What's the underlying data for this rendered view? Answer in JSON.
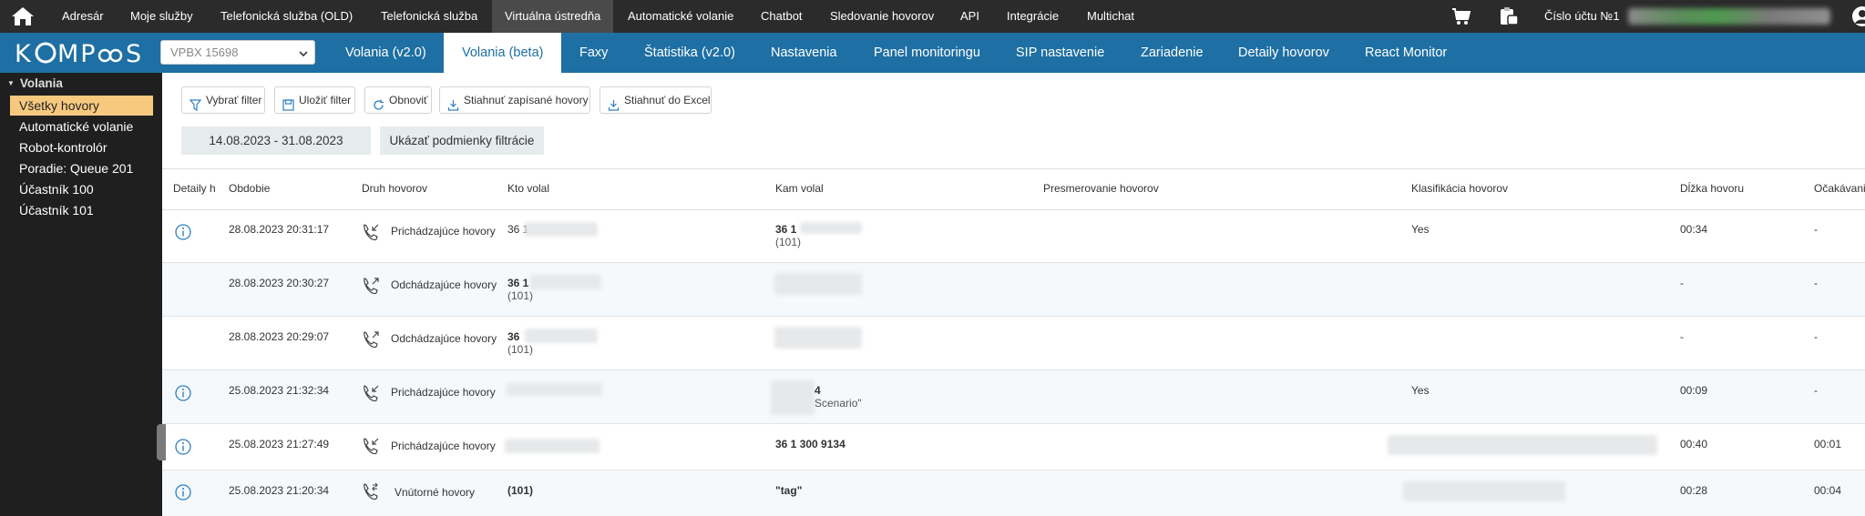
{
  "topnav": {
    "items": [
      "Adresár",
      "Moje služby",
      "Telefonická služba (OLD)",
      "Telefonická služba",
      "Virtuálna ústredňa",
      "Automatické volanie",
      "Chatbot",
      "Sledovanie hovorov",
      "API",
      "Integrácie",
      "Multichat"
    ],
    "active": "Virtuálna ústredňa",
    "account_label": "Číslo účtu №1"
  },
  "brand": {
    "logo_text": "KOMPaaS"
  },
  "pbx_select": {
    "value": "VPBX 15698"
  },
  "subtabs": [
    "Volania (v2.0)",
    "Volania (beta)",
    "Faxy",
    "Štatistika (v2.0)",
    "Nastavenia",
    "Panel monitoringu",
    "SIP nastavenie",
    "Zariadenie",
    "Detaily hovorov",
    "React Monitor"
  ],
  "sidebar": {
    "group": "Volania",
    "items": [
      "Všetky hovory",
      "Automatické volanie",
      "Robot-kontrolór",
      "Poradie: Queue 201",
      "Účastník 100",
      "Účastník 101"
    ]
  },
  "toolbar": {
    "select_filter": "Vybrať filter",
    "save_filter": "Uložiť filter",
    "refresh": "Obnoviť",
    "download_recorded": "Stiahnuť zapísané hovory",
    "download_excel": "Stiahnuť do Excel",
    "date_range": "14.08.2023 - 31.08.2023",
    "show_conditions": "Ukázať podmienky filtrácie"
  },
  "table": {
    "headers": [
      "Detaily h",
      "Obdobie",
      "Druh hovorov",
      "Kto volal",
      "Kam volal",
      "Presmerovanie hovorov",
      "Klasifikácia hovorov",
      "Dĺžka hovoru",
      "Očakávani"
    ],
    "rows": [
      {
        "period": "28.08.2023 20:31:17",
        "type": "Prichádzajúce hovory",
        "from": "36 1",
        "from_sub": "",
        "to": "36 1",
        "to_sub": "(101)",
        "class": "Yes",
        "dur": "00:34",
        "wait": "-"
      },
      {
        "period": "28.08.2023 20:30:27",
        "type": "Odchádzajúce hovory",
        "from": "36 1",
        "from_sub": "(101)",
        "to": "",
        "to_sub": "",
        "class": "",
        "dur": "-",
        "wait": "-"
      },
      {
        "period": "28.08.2023 20:29:07",
        "type": "Odchádzajúce hovory",
        "from": "36",
        "from_sub": "(101)",
        "to": "",
        "to_sub": "",
        "class": "",
        "dur": "-",
        "wait": "-"
      },
      {
        "period": "25.08.2023 21:32:34",
        "type": "Prichádzajúce hovory",
        "from": "",
        "from_sub": "",
        "to": "4",
        "to_sub": "Scenario\"",
        "class": "Yes",
        "dur": "00:09",
        "wait": "-"
      },
      {
        "period": "25.08.2023 21:27:49",
        "type": "Prichádzajúce hovory",
        "from": "",
        "from_sub": "",
        "to": "36 1 300 9134",
        "to_sub": "",
        "class": "",
        "dur": "00:40",
        "wait": "00:01"
      },
      {
        "period": "25.08.2023 21:20:34",
        "type": "Vnútorné hovory",
        "from": "(101)",
        "from_sub": "",
        "to": "\"tag\"",
        "to_sub": "",
        "class": "",
        "dur": "00:28",
        "wait": "00:04"
      }
    ]
  },
  "colors": {
    "topbar": "#2b2b2b",
    "subbar": "#1e6fa3",
    "sidebar": "#1f1f1f",
    "sidebar_active": "#f6c97f",
    "info": "#2f7fc1"
  }
}
